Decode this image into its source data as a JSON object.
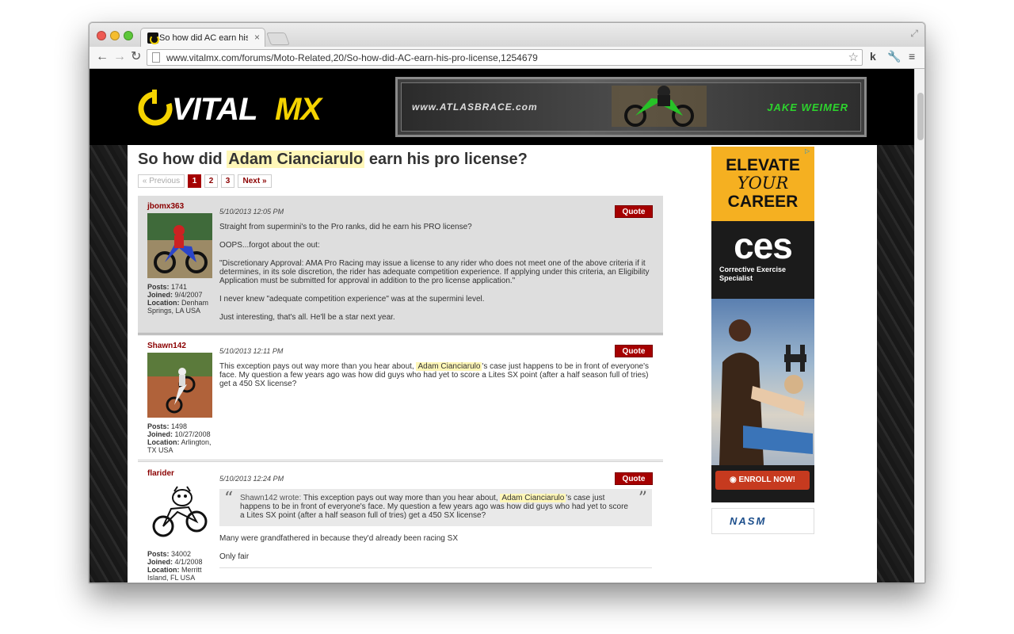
{
  "browser": {
    "tab_title": "So how did AC earn his pro license",
    "tab_close": "×",
    "url": "www.vitalmx.com/forums/Moto-Related,20/So-how-did-AC-earn-his-pro-license,1254679",
    "icons": [
      "close-light",
      "minimize-light",
      "zoom-light",
      "back-icon",
      "forward-icon",
      "reload-icon",
      "star-icon",
      "k-extension-icon",
      "wrench-icon",
      "menu-icon",
      "fullscreen-icon"
    ]
  },
  "site": {
    "logo_text": "VITALMX",
    "banner_url": "www.ATLASBRACE.com",
    "banner_name": "JAKE WEIMER"
  },
  "thread": {
    "title_before": "So how did ",
    "title_highlight": "Adam Cianciarulo",
    "title_after": " earn his pro license?",
    "pager": {
      "prev": "« Previous",
      "pages": [
        "1",
        "2",
        "3"
      ],
      "active_page": "1",
      "next": "Next »"
    }
  },
  "posts": [
    {
      "username": "jbomx363",
      "date": "5/10/2013 12:05 PM",
      "quote_label": "Quote",
      "stats": {
        "posts_label": "Posts:",
        "posts": "1741",
        "joined_label": "Joined:",
        "joined": "9/4/2007",
        "location_label": "Location:",
        "location": "Denham Springs, LA USA"
      },
      "paragraphs": [
        "Straight from supermini's to the Pro ranks, did he earn his PRO license?",
        "OOPS...forgot about the out:",
        "\"Discretionary Approval: AMA Pro Racing may issue a license to any rider who does not meet one of the above criteria if it determines, in its sole discretion, the rider has adequate competition experience. If applying under this criteria, an Eligibility Application must be submitted for approval in addition to the pro license application.\"",
        "I never knew \"adequate competition experience\" was at the supermini level.",
        "Just interesting, that's all. He'll be a star next year."
      ]
    },
    {
      "username": "Shawn142",
      "date": "5/10/2013 12:11 PM",
      "quote_label": "Quote",
      "stats": {
        "posts_label": "Posts:",
        "posts": "1498",
        "joined_label": "Joined:",
        "joined": "10/27/2008",
        "location_label": "Location:",
        "location": "Arlington, TX USA"
      },
      "body_before": "This exception pays out way more than you hear about, ",
      "body_highlight": "Adam Cianciarulo",
      "body_after": "'s case just happens to be in front of everyone's face. My question a few years ago was how did guys who had yet to score a Lites SX point (after a half season full of tries) get a 450 SX license?"
    },
    {
      "username": "flarider",
      "date": "5/10/2013 12:24 PM",
      "quote_label": "Quote",
      "stats": {
        "posts_label": "Posts:",
        "posts": "34002",
        "joined_label": "Joined:",
        "joined": "4/1/2008",
        "location_label": "Location:",
        "location": "Merritt Island, FL USA"
      },
      "quote_open": "“",
      "quote_close": "”",
      "quote_author": "Shawn142 wrote:",
      "quote_before": " This exception pays out way more than you hear about, ",
      "quote_highlight": "Adam Cianciarulo",
      "quote_after": "'s case just happens to be in front of everyone's face. My question a few years ago was how did guys who had yet to score a Lites SX point (after a half season full of tries) get a 450 SX license?",
      "paragraphs": [
        "Many were grandfathered in because they'd already been racing SX",
        "Only fair"
      ]
    }
  ],
  "ad": {
    "elevate": "ELEVATE",
    "your": "YOUR",
    "career": "CAREER",
    "ces": "ces",
    "sub1": "Corrective Exercise",
    "sub2": "Specialist",
    "enroll": "ENROLL NOW!",
    "brand": "NASM"
  }
}
